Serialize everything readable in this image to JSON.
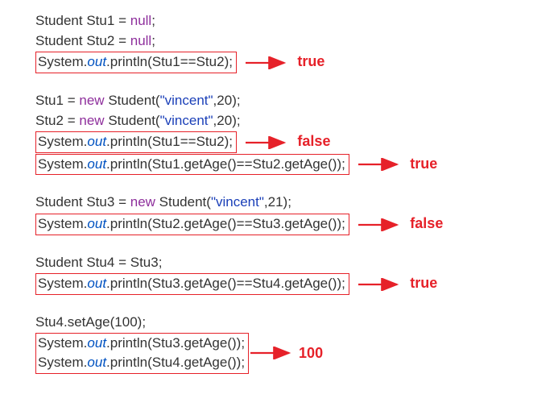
{
  "tokens": {
    "type": "Student",
    "v1": "Stu1",
    "v2": "Stu2",
    "v3": "Stu3",
    "v4": "Stu4",
    "assign": "=",
    "null": "null",
    "semi": ";",
    "new": "new",
    "ctor": "Student",
    "open": "(",
    "close": ")",
    "str1": "\"vincent\"",
    "comma": ",",
    "n20": "20",
    "n21": "21",
    "n100": "100",
    "System": "System.",
    "out": "out",
    "println": ".println(",
    "eqeq": "==",
    "getAge": ".getAge()",
    "setAge": ".setAge("
  },
  "results": {
    "r1": "true",
    "r2": "false",
    "r3": "true",
    "r4": "false",
    "r5": "true",
    "r6": "100"
  }
}
